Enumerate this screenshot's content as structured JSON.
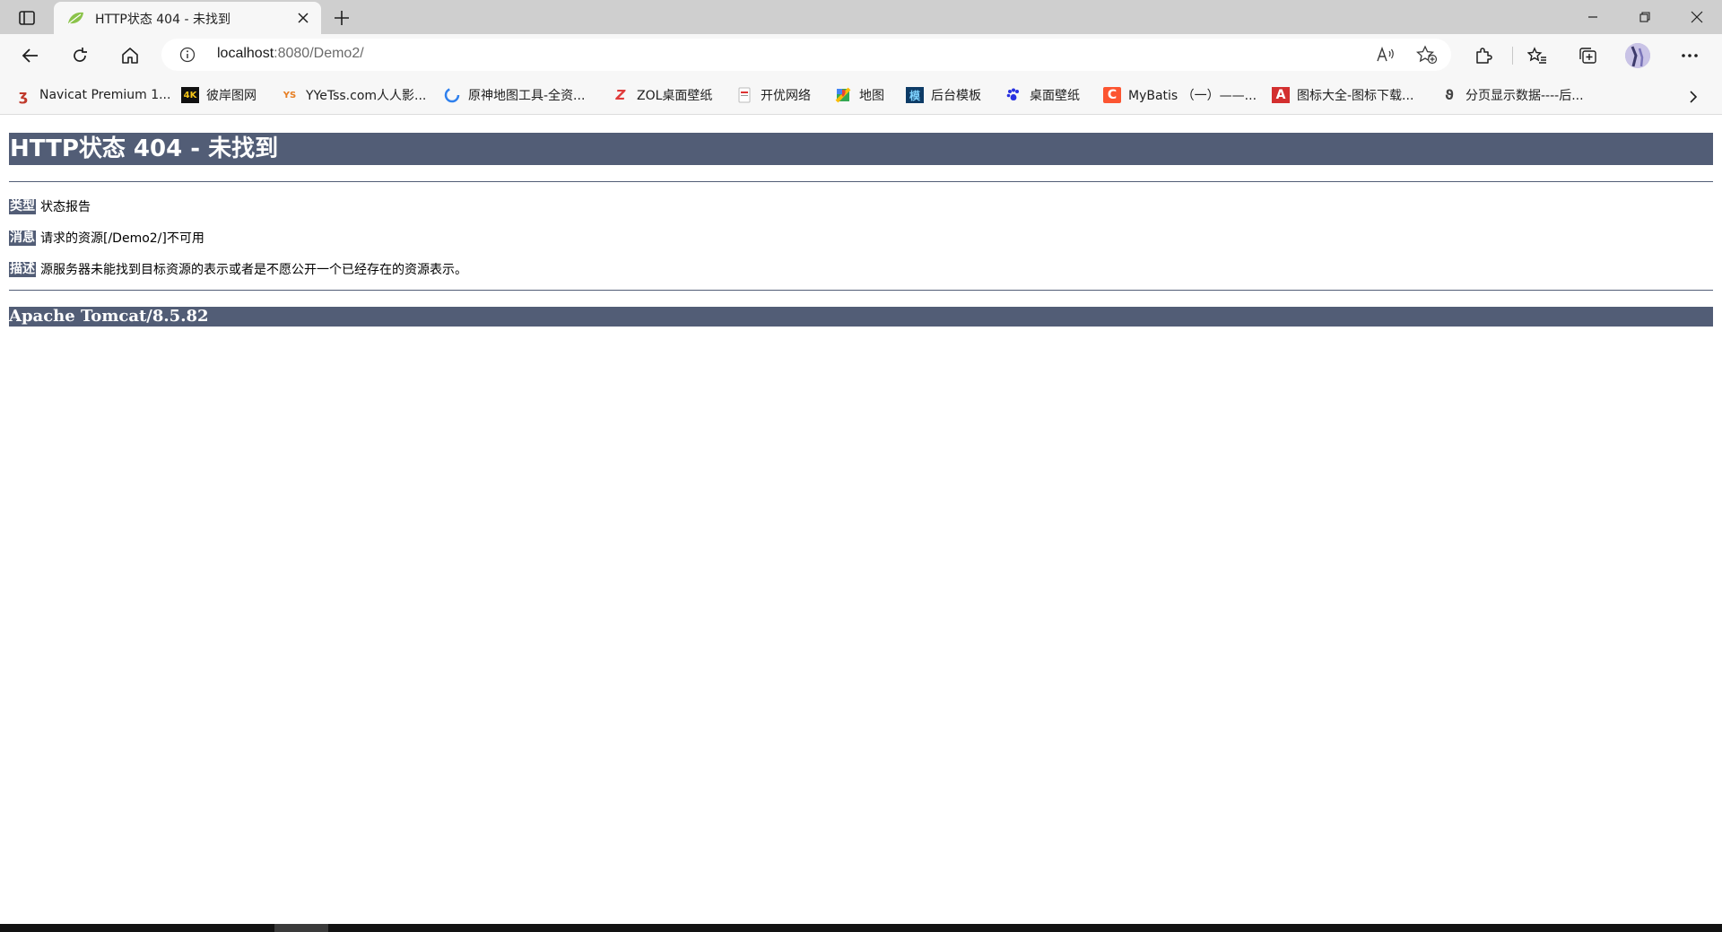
{
  "tab": {
    "title": "HTTP状态 404 - 未找到",
    "favicon": "spring-leaf-icon"
  },
  "address": {
    "host": "localhost",
    "rest": ":8080/Demo2/"
  },
  "bookmarks": [
    {
      "label": "Navicat Premium 1...",
      "icon": "navicat-icon",
      "color": "#c0392b",
      "glyph": "ⁿ"
    },
    {
      "label": "彼岸图网",
      "icon": "4k-icon",
      "color": "#111111",
      "glyph": "4K"
    },
    {
      "label": "YYeTss.com人人影...",
      "icon": "yyets-icon",
      "color": "#e67e22",
      "glyph": "YS"
    },
    {
      "label": "原神地图工具-全资...",
      "icon": "genshin-map-icon",
      "color": "#2f80ed",
      "glyph": "↻"
    },
    {
      "label": "ZOL桌面壁纸",
      "icon": "zol-icon",
      "color": "#e03a3a",
      "glyph": "Z"
    },
    {
      "label": "开优网络",
      "icon": "kaiyou-icon",
      "color": "#d33",
      "glyph": "K"
    },
    {
      "label": "地图",
      "icon": "map-icon",
      "color": "#34a853",
      "glyph": "◆"
    },
    {
      "label": "后台模板",
      "icon": "template-icon",
      "color": "#0d3b66",
      "glyph": "模"
    },
    {
      "label": "桌面壁纸",
      "icon": "baidu-paw-icon",
      "color": "#2932e1",
      "glyph": "❀"
    },
    {
      "label": "MyBatis （一）——...",
      "icon": "csdn-icon",
      "color": "#fc5531",
      "glyph": "C"
    },
    {
      "label": "图标大全-图标下载...",
      "icon": "iconfont-icon",
      "color": "#d32f2f",
      "glyph": "A"
    },
    {
      "label": "分页显示数据----后...",
      "icon": "page-icon",
      "color": "#555555",
      "glyph": "ϑ"
    }
  ],
  "page": {
    "heading": "HTTP状态 404 - 未找到",
    "rows": [
      {
        "key": "类型",
        "value": "状态报告"
      },
      {
        "key": "消息",
        "value": "请求的资源[/Demo2/]不可用"
      },
      {
        "key": "描述",
        "value": "源服务器未能找到目标资源的表示或者是不愿公开一个已经存在的资源表示。"
      }
    ],
    "server": "Apache Tomcat/8.5.82"
  },
  "colors": {
    "tomcat_bar": "#525d76",
    "tab_strip": "#cfcfcf",
    "toolbar": "#f7f7f7"
  }
}
